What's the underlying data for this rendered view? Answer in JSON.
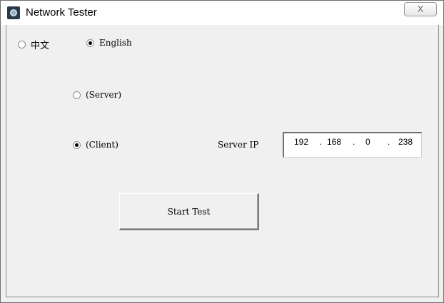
{
  "window": {
    "title": "Network Tester",
    "close_glyph": "X"
  },
  "language": {
    "options": [
      {
        "label": "中文",
        "checked": false
      },
      {
        "label": "English",
        "checked": true
      }
    ]
  },
  "mode": {
    "server_label": "(Server)",
    "server_checked": false,
    "client_label": "(Client)",
    "client_checked": true
  },
  "server_ip": {
    "label": "Server IP",
    "octets": [
      "192",
      "168",
      "0",
      "238"
    ]
  },
  "actions": {
    "start_label": "Start Test"
  },
  "colors": {
    "dialog_bg": "#f0f0f0",
    "title_bg": "#ffffff"
  }
}
